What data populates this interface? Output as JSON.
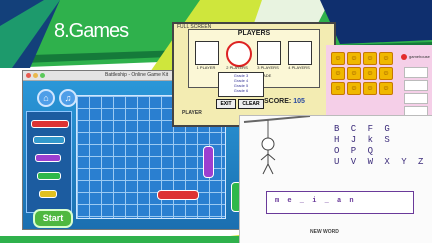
{
  "slide": {
    "title": "8.Games"
  },
  "battleship": {
    "window_title": "Battleship - Online Game Kit",
    "home_icon": "home-icon",
    "sound_icon": "sound-icon",
    "start_label": "Start"
  },
  "players": {
    "top_note": "FULL SCREEN",
    "title": "PLAYERS",
    "options": [
      "1 PLAYER",
      "2 PLAYERS",
      "3 PLAYERS",
      "4 PLAYERS"
    ],
    "select_label": "CHOOSE GRADE",
    "grades": [
      "Grade 3",
      "Grade 4",
      "Grade 5",
      "Grade 6"
    ],
    "exit_label": "EXIT",
    "clear_label": "CLEAR",
    "score_label": "SCORE:",
    "score_value": "105",
    "bottom_text": "PLAYER"
  },
  "emoji_game": {
    "logo_text": "gamehouse"
  },
  "hangman": {
    "letters_row1": "B C   F G",
    "letters_row2": "H   J k   S",
    "letters_row3": "O P Q",
    "letters_row4": "U V W X Y Z",
    "word_display": "m e _ i _ a n",
    "caption": "NEW WORD"
  },
  "colors": {
    "green_band": "#2fb14c",
    "lime_band": "#cfe63c",
    "navy_band": "#0f2f6e",
    "battleship_sea": "#1f86c9"
  }
}
